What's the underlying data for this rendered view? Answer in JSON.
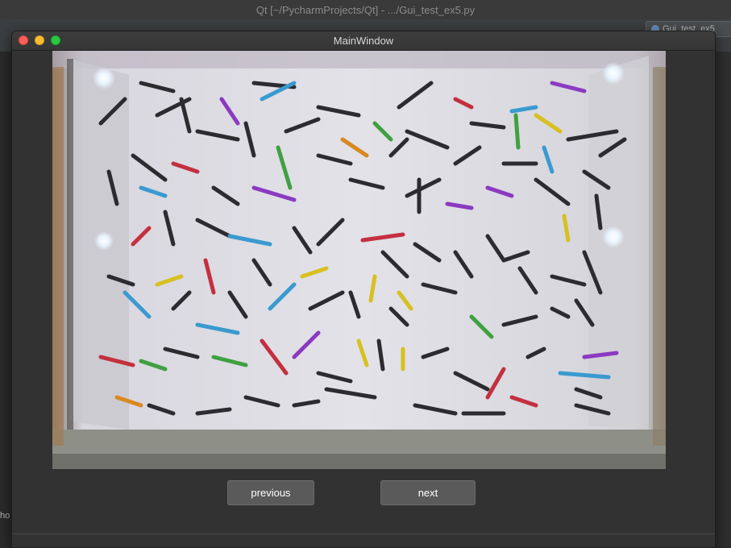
{
  "ide": {
    "title": "Qt [~/PycharmProjects/Qt] - .../Gui_test_ex5.py",
    "run_config": "Gui_test_ex5",
    "left_fragment": "ho"
  },
  "window": {
    "title": "MainWindow"
  },
  "buttons": {
    "previous": "previous",
    "next": "next"
  },
  "colors": {
    "window_bg": "#323232",
    "button_bg": "#5a5a5a",
    "close": "#ff5f57",
    "minimize": "#febc2e",
    "maximize": "#28c840"
  }
}
